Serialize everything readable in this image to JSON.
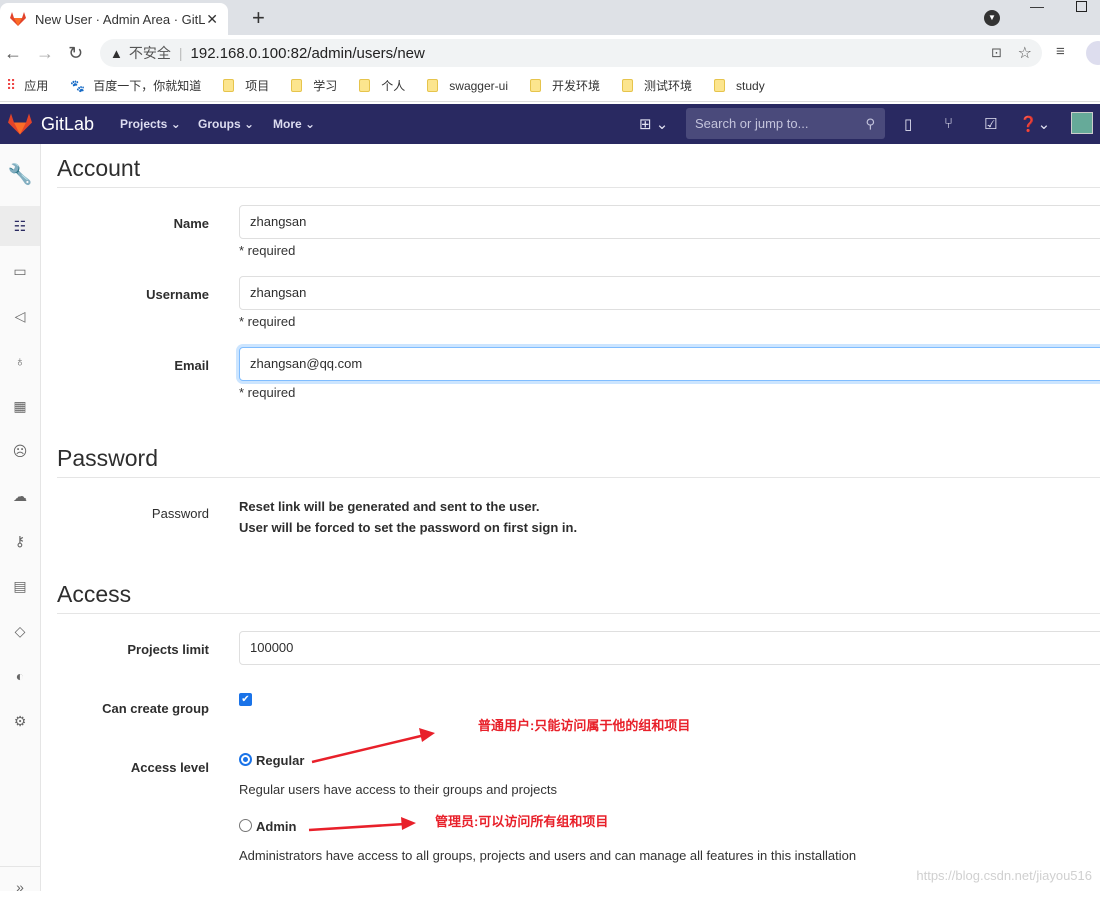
{
  "browser": {
    "tab_title": "New User · Admin Area · GitLab",
    "not_secure": "不安全",
    "url": "192.168.0.100:82/admin/users/new",
    "bookmarks": [
      {
        "label": "应用",
        "icon": "apps-icon"
      },
      {
        "label": "百度一下，你就知道",
        "icon": "baidu-icon"
      },
      {
        "label": "项目",
        "icon": "folder-icon"
      },
      {
        "label": "学习",
        "icon": "folder-icon"
      },
      {
        "label": "个人",
        "icon": "folder-icon"
      },
      {
        "label": "swagger-ui",
        "icon": "folder-icon"
      },
      {
        "label": "开发环境",
        "icon": "folder-icon"
      },
      {
        "label": "测试环境",
        "icon": "folder-icon"
      },
      {
        "label": "study",
        "icon": "folder-icon"
      }
    ]
  },
  "navbar": {
    "brand": "GitLab",
    "menus": [
      "Projects",
      "Groups",
      "More"
    ],
    "search_placeholder": "Search or jump to...",
    "brand_color": "#292961"
  },
  "account": {
    "heading": "Account",
    "name": {
      "label": "Name",
      "value": "zhangsan",
      "hint": "* required"
    },
    "username": {
      "label": "Username",
      "value": "zhangsan",
      "hint": "* required"
    },
    "email": {
      "label": "Email",
      "value": "zhangsan@qq.com",
      "hint": "* required"
    }
  },
  "password": {
    "heading": "Password",
    "label": "Password",
    "line1": "Reset link will be generated and sent to the user.",
    "line2": "User will be forced to set the password on first sign in."
  },
  "access": {
    "heading": "Access",
    "projects_limit": {
      "label": "Projects limit",
      "value": "100000"
    },
    "can_create_group": {
      "label": "Can create group",
      "checked": true
    },
    "access_level": {
      "label": "Access level",
      "selected": "Regular",
      "regular": {
        "label": "Regular",
        "desc": "Regular users have access to their groups and projects"
      },
      "admin": {
        "label": "Admin",
        "desc": "Administrators have access to all groups, projects and users and can manage all features in this installation"
      }
    }
  },
  "annotations": {
    "regular": "普通用户:只能访问属于他的组和项目",
    "admin": "管理员:可以访问所有组和项目",
    "color": "#e8202a"
  },
  "watermark": "https://blog.csdn.net/jiayou516"
}
